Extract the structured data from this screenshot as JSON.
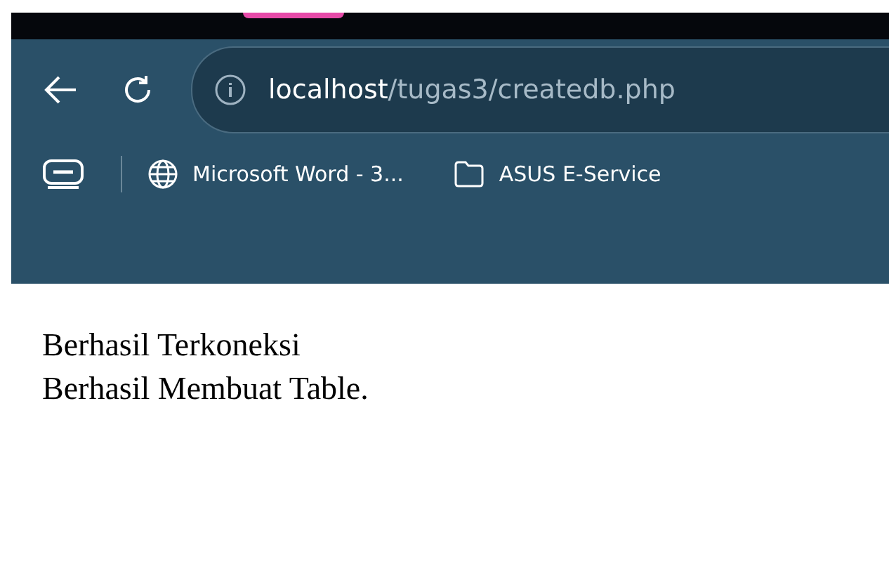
{
  "address_bar": {
    "host": "localhost",
    "path": "/tugas3/createdb.php"
  },
  "bookmarks": [
    {
      "kind": "page",
      "label": "Microsoft Word - 3..."
    },
    {
      "kind": "folder",
      "label": "ASUS E-Service"
    }
  ],
  "page": {
    "lines": [
      "Berhasil Terkoneksi",
      "Berhasil Membuat Table."
    ]
  }
}
